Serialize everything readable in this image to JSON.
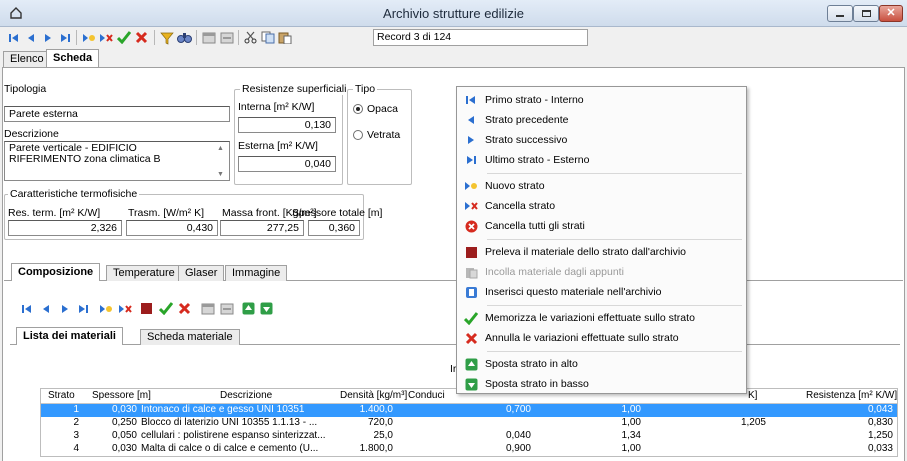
{
  "window": {
    "title": "Archivio strutture edilizie"
  },
  "toolbar": {
    "record_text": "Record 3 di 124"
  },
  "tabs": {
    "main": [
      "Elenco",
      "Scheda"
    ],
    "sub": [
      "Composizione",
      "Temperature",
      "Glaser",
      "Immagine"
    ],
    "inner": [
      "Lista dei materiali",
      "Scheda materiale"
    ]
  },
  "form": {
    "tipologia_label": "Tipologia",
    "tipologia_value": "Parete esterna",
    "descrizione_label": "Descrizione",
    "descrizione_value": "Parete verticale - EDIFICIO RIFERIMENTO zona climatica B",
    "resistenze_title": "Resistenze superficiali",
    "interna_label": "Interna [m² K/W]",
    "interna_value": "0,130",
    "esterna_label": "Esterna  [m² K/W]",
    "esterna_value": "0,040",
    "tipo_title": "Tipo",
    "tipo_opaca": "Opaca",
    "tipo_vetrata": "Vetrata",
    "caratteristiche_title": "Caratteristiche termofisiche",
    "res_term_label": "Res. term. [m² K/W]",
    "res_term_value": "2,326",
    "trasm_label": "Trasm. [W/m² K]",
    "trasm_value": "0,430",
    "massa_label": "Massa front. [Kg/m²]",
    "massa_value": "277,25",
    "spessore_label": "Spessore totale [m]",
    "spessore_value": "0,360"
  },
  "grid": {
    "group_partial": "Ir",
    "headers": [
      "Strato",
      "Spessore [m]",
      "Descrizione",
      "Densità [kg/m³]",
      "Conduci",
      "K]",
      "Resistenza [m² K/W]"
    ],
    "rows": [
      {
        "strato": "1",
        "spessore": "0,030",
        "descrizione": "Intonaco di calce e gesso UNI 10351",
        "densita": "1.400,0",
        "c4": "0,700",
        "c5": "1,00",
        "c6": "",
        "resistenza": "0,043"
      },
      {
        "strato": "2",
        "spessore": "0,250",
        "descrizione": "Blocco di laterizio UNI 10355 1.1.13 - ...",
        "densita": "720,0",
        "c4": "",
        "c5": "1,00",
        "c6": "1,205",
        "resistenza": "0,830"
      },
      {
        "strato": "3",
        "spessore": "0,050",
        "descrizione": "cellulari : polistirene espanso sinterizzat...",
        "densita": "25,0",
        "c4": "0,040",
        "c5": "1,34",
        "c6": "",
        "resistenza": "1,250"
      },
      {
        "strato": "4",
        "spessore": "0,030",
        "descrizione": "Malta di calce o di calce e cemento (U...",
        "densita": "1.800,0",
        "c4": "0,900",
        "c5": "1,00",
        "c6": "",
        "resistenza": "0,033"
      }
    ]
  },
  "context_menu": {
    "items": [
      {
        "label": "Primo strato - Interno",
        "icon": "first-icon"
      },
      {
        "label": "Strato precedente",
        "icon": "prev-icon"
      },
      {
        "label": "Strato successivo",
        "icon": "next-icon"
      },
      {
        "label": "Ultimo strato - Esterno",
        "icon": "last-icon"
      },
      {
        "label": "Nuovo strato",
        "icon": "new-layer-icon"
      },
      {
        "label": "Cancella strato",
        "icon": "delete-layer-icon"
      },
      {
        "label": "Cancella tutti gli strati",
        "icon": "delete-all-icon"
      },
      {
        "label": "Preleva il materiale dello strato dall'archivio",
        "icon": "archive-pick-icon"
      },
      {
        "label": "Incolla materiale dagli appunti",
        "icon": "paste-icon",
        "disabled": true
      },
      {
        "label": "Inserisci questo materiale nell'archivio",
        "icon": "archive-insert-icon"
      },
      {
        "label": "Memorizza le variazioni effettuate sullo strato",
        "icon": "checkmark-icon"
      },
      {
        "label": "Annulla le variazioni effettuate sullo strato",
        "icon": "cross-icon"
      },
      {
        "label": "Sposta strato in alto",
        "icon": "move-up-icon"
      },
      {
        "label": "Sposta strato in basso",
        "icon": "move-down-icon"
      }
    ]
  },
  "colors": {
    "accent_blue": "#2b6fd0",
    "selection": "#3399ff",
    "check_green": "#2aa52a",
    "cross_red": "#d62b1f"
  }
}
